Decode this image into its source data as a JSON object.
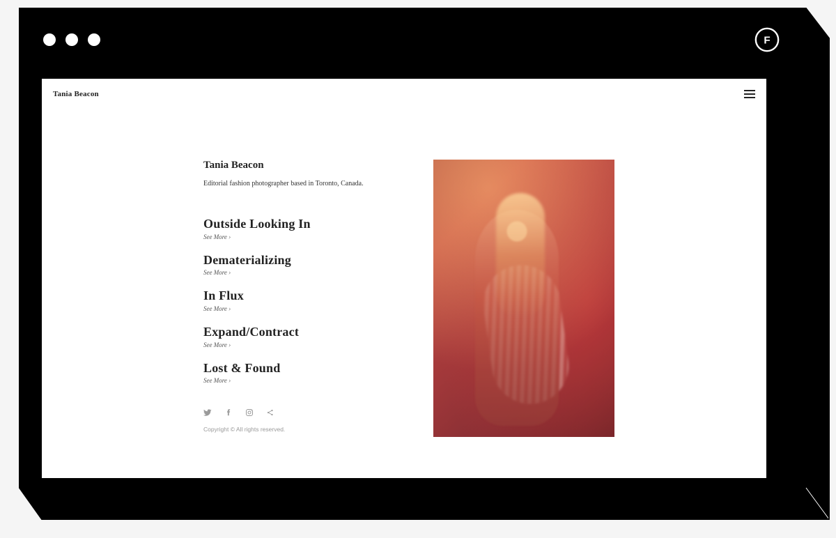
{
  "browser": {
    "badge_letter": "F"
  },
  "header": {
    "site_name": "Tania Beacon"
  },
  "intro": {
    "title": "Tania Beacon",
    "tagline": "Editorial fashion photographer based in Toronto, Canada."
  },
  "see_more_label": "See More ›",
  "projects": [
    {
      "title": "Outside Looking In"
    },
    {
      "title": "Dematerializing"
    },
    {
      "title": "In Flux"
    },
    {
      "title": "Expand/Contract"
    },
    {
      "title": "Lost & Found"
    }
  ],
  "footer": {
    "copyright": "Copyright © All rights reserved."
  }
}
